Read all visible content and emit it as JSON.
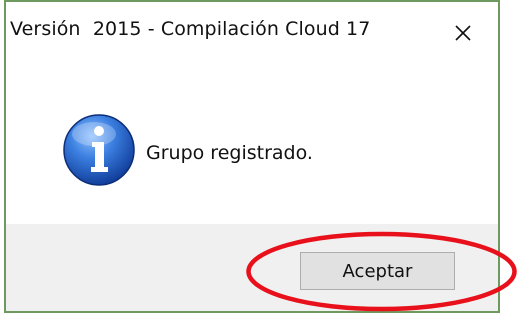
{
  "dialog": {
    "title": "Versión  2015 - Compilación Cloud 17",
    "message": "Grupo registrado.",
    "ok_label": "Aceptar",
    "icon": "info-icon",
    "close_icon": "close-icon"
  },
  "annotation": {
    "shape": "ellipse",
    "color": "#e8101a",
    "target": "ok-button"
  },
  "colors": {
    "border": "#6e9a5f",
    "footer": "#f0f0f0",
    "button_face": "#e1e1e1",
    "info_blue": "#2f6fd1"
  }
}
